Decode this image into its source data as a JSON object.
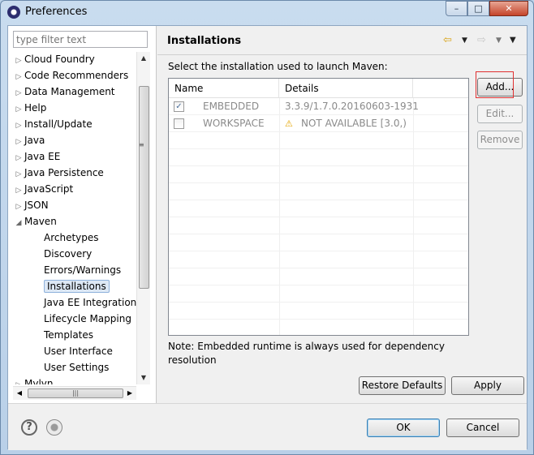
{
  "window": {
    "title": "Preferences",
    "minimize": "–",
    "maximize": "□",
    "close": "✕"
  },
  "filter": {
    "placeholder": "type filter text"
  },
  "tree": {
    "items": [
      {
        "label": "Cloud Foundry",
        "arrow": "▷"
      },
      {
        "label": "Code Recommenders",
        "arrow": "▷"
      },
      {
        "label": "Data Management",
        "arrow": "▷"
      },
      {
        "label": "Help",
        "arrow": "▷"
      },
      {
        "label": "Install/Update",
        "arrow": "▷"
      },
      {
        "label": "Java",
        "arrow": "▷"
      },
      {
        "label": "Java EE",
        "arrow": "▷"
      },
      {
        "label": "Java Persistence",
        "arrow": "▷"
      },
      {
        "label": "JavaScript",
        "arrow": "▷"
      },
      {
        "label": "JSON",
        "arrow": "▷"
      },
      {
        "label": "Maven",
        "arrow": "◢"
      },
      {
        "label": "Archetypes"
      },
      {
        "label": "Discovery"
      },
      {
        "label": "Errors/Warnings"
      },
      {
        "label": "Installations",
        "selected": true
      },
      {
        "label": "Java EE Integration"
      },
      {
        "label": "Lifecycle Mapping"
      },
      {
        "label": "Templates"
      },
      {
        "label": "User Interface"
      },
      {
        "label": "User Settings"
      },
      {
        "label": "Mylyn",
        "arrow": "▷"
      }
    ]
  },
  "page": {
    "title": "Installations",
    "instruction": "Select the installation used to launch Maven:",
    "columns": {
      "name": "Name",
      "details": "Details"
    },
    "rows": [
      {
        "checked": true,
        "name": "EMBEDDED",
        "details": "3.3.9/1.7.0.20160603-1931",
        "warning": false
      },
      {
        "checked": false,
        "name": "WORKSPACE",
        "details": "NOT AVAILABLE [3.0,)",
        "warning": true
      }
    ],
    "buttons": {
      "add": "Add...",
      "edit": "Edit...",
      "remove": "Remove"
    },
    "note": "Note: Embedded runtime is always used for dependency resolution",
    "restore_defaults": "Restore Defaults",
    "apply": "Apply"
  },
  "footer": {
    "ok": "OK",
    "cancel": "Cancel",
    "help_icon": "?"
  },
  "colors": {
    "selection": "#dde8f5",
    "ok_border": "#3c7fb1",
    "highlight": "#e03030",
    "warning": "#e4a400"
  }
}
